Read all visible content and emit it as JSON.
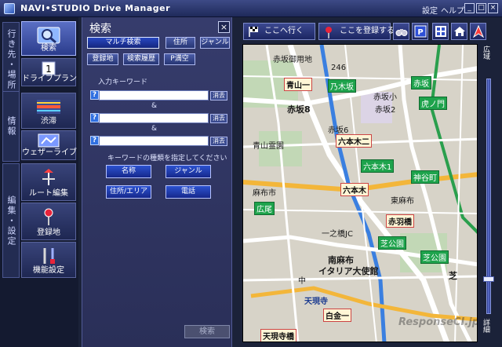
{
  "app": {
    "title": "NAVI•STUDIO  Drive Manager"
  },
  "title_menu": {
    "settings": "設定",
    "help": "ヘルプ"
  },
  "window_buttons": {
    "minimize": "_",
    "maximize": "□",
    "close": "×"
  },
  "left_nav": {
    "groups": [
      {
        "label": "行き先・場所"
      },
      {
        "label": "情報"
      },
      {
        "label": "編集・設定"
      }
    ],
    "items": [
      {
        "label": "検索",
        "icon": "magnifier-icon",
        "active": true
      },
      {
        "label": "ドライブプラン",
        "icon": "calendar-icon",
        "badge": "1"
      },
      {
        "label": "渋滞",
        "icon": "traffic-icon"
      },
      {
        "label": "ウェザーライブ",
        "icon": "weather-icon"
      },
      {
        "label": "ルート編集",
        "icon": "route-edit-icon"
      },
      {
        "label": "登録地",
        "icon": "pin-icon"
      },
      {
        "label": "機能設定",
        "icon": "tools-icon"
      }
    ]
  },
  "search_panel": {
    "title": "検索",
    "close": "×",
    "tabs_row1": [
      "マルチ検索",
      "住所",
      "ジャンル"
    ],
    "tabs_row2": [
      "登録地",
      "検索履歴",
      "P満空"
    ],
    "keyword_label": "入力キーワード",
    "help_glyph": "?",
    "fields": [
      {
        "value": "",
        "clear": "消去"
      },
      {
        "value": "",
        "clear": "消去"
      },
      {
        "value": "",
        "clear": "消去"
      }
    ],
    "amp": "&",
    "type_prompt": "キーワードの種類を指定してください",
    "type_buttons": [
      "名称",
      "ジャンル",
      "住所/エリア",
      "電話"
    ],
    "search_button": "検索"
  },
  "map_toolbar": {
    "go_here": "ここへ行く",
    "register_here": "ここを登録する",
    "parking_badge": "P"
  },
  "map": {
    "labels": [
      {
        "text": "赤坂御用地",
        "style": "plain"
      },
      {
        "text": "青山一",
        "style": "boxed"
      },
      {
        "text": "246",
        "style": "plain"
      },
      {
        "text": "乃木坂",
        "style": "green"
      },
      {
        "text": "赤坂",
        "style": "green"
      },
      {
        "text": "赤坂8",
        "style": "big"
      },
      {
        "text": "赤坂小",
        "style": "plain"
      },
      {
        "text": "赤坂2",
        "style": "plain"
      },
      {
        "text": "虎ノ門",
        "style": "green"
      },
      {
        "text": "赤坂6",
        "style": "plain"
      },
      {
        "text": "六本木二",
        "style": "boxed"
      },
      {
        "text": "六本木1",
        "style": "green"
      },
      {
        "text": "青山霊園",
        "style": "plain"
      },
      {
        "text": "神谷町",
        "style": "green"
      },
      {
        "text": "六本木",
        "style": "boxed"
      },
      {
        "text": "麻布市",
        "style": "plain"
      },
      {
        "text": "東麻布",
        "style": "plain"
      },
      {
        "text": "広尾",
        "style": "green"
      },
      {
        "text": "赤羽橋",
        "style": "boxed"
      },
      {
        "text": "芝公園",
        "style": "green"
      },
      {
        "text": "一之橋JC",
        "style": "plain"
      },
      {
        "text": "芝公園",
        "style": "green"
      },
      {
        "text": "南麻布",
        "style": "plain"
      },
      {
        "text": "イタリア大使館",
        "style": "plain"
      },
      {
        "text": "天現寺",
        "style": "blue"
      },
      {
        "text": "白金一",
        "style": "boxed"
      },
      {
        "text": "天現寺橋",
        "style": "boxed"
      },
      {
        "text": "芝",
        "style": "plain"
      },
      {
        "text": "中",
        "style": "plain"
      },
      {
        "text": "ResponseCI.jp",
        "style": "watermark"
      }
    ]
  },
  "zoom": {
    "wide_label": "広域",
    "detail_label": "詳細",
    "level": 0.86
  }
}
